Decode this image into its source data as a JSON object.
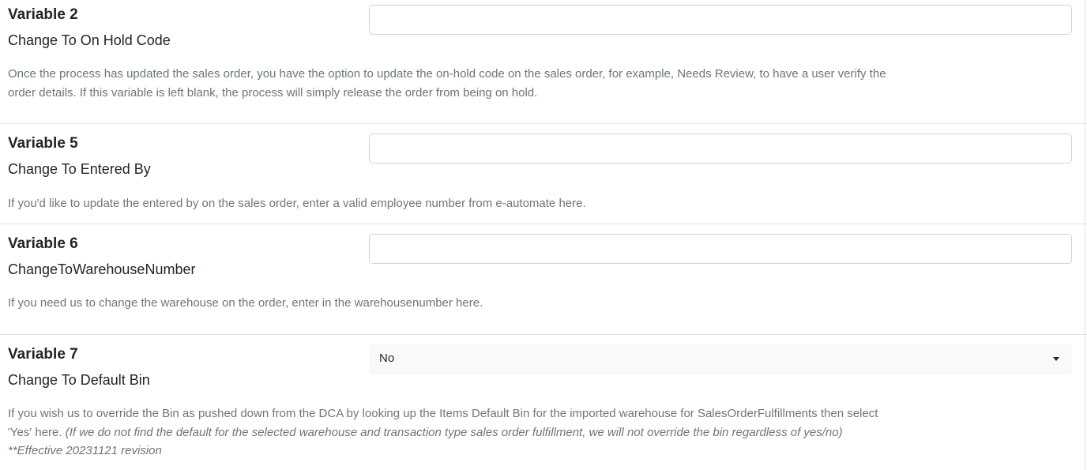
{
  "variables": [
    {
      "title": "Variable 2",
      "subtitle": "Change To On Hold Code",
      "description": "Once the process has updated the sales order, you have the option to update the on-hold code on the sales order, for example, Needs Review, to have a user verify the order details. If this variable is left blank, the process will simply release the order from being on hold.",
      "value": ""
    },
    {
      "title": "Variable 5",
      "subtitle": "Change To Entered By",
      "description": "If you'd like to update the entered by on the sales order, enter a valid employee number from e-automate here.",
      "value": ""
    },
    {
      "title": "Variable 6",
      "subtitle": "ChangeToWarehouseNumber",
      "description": "If you need us to change the warehouse on the order, enter in the warehousenumber here.",
      "value": ""
    },
    {
      "title": "Variable 7",
      "subtitle": "Change To Default Bin",
      "description_plain": "If you wish us to override the Bin as pushed down from the DCA by looking up the Items Default Bin for the imported warehouse for SalesOrderFulfillments then select 'Yes' here. ",
      "description_italic": "(If we do not find the default for the selected warehouse and transaction type sales order fulfillment, we will not override the bin regardless of yes/no) **Effective 20231121 revision",
      "selected_value": "No"
    }
  ]
}
